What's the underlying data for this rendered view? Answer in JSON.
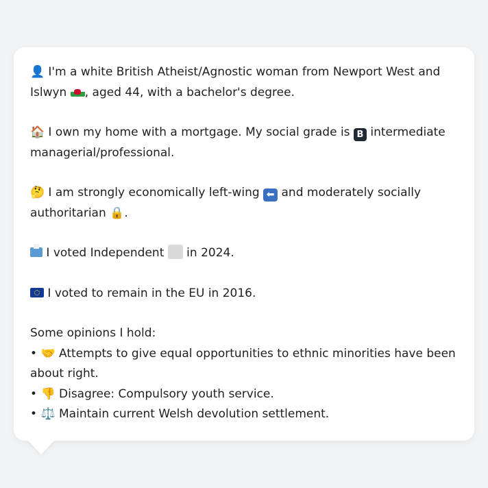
{
  "bio": {
    "line1_icon": "person-silhouette-icon",
    "line1_a": "I'm a white British Atheist/Agnostic woman from Newport West and Islwyn",
    "line1_flag": "wales-flag-icon",
    "line1_b": ", aged 44, with a bachelor's degree.",
    "line2_icon": "house-icon",
    "line2_a": "I own my home with a mortgage. My social grade is",
    "line2_badge": "B",
    "line2_b": "intermediate managerial/professional.",
    "line3_icon": "thinking-face-icon",
    "line3_a": "I am strongly economically left-wing",
    "line3_arrow": "⬅",
    "line3_b": "and moderately socially authoritarian",
    "line3_lock": "🔒",
    "line3_end": ".",
    "line4_icon": "ballot-box-icon",
    "line4_a": "I voted Independent",
    "line4_b": "in 2024.",
    "line5_icon": "eu-flag-icon",
    "line5_a": "I voted to remain in the EU in 2016."
  },
  "opinions": {
    "heading": "Some opinions I hold:",
    "items": [
      {
        "bullet": "•",
        "icon": "🤝",
        "text": "Attempts to give equal opportunities to ethnic minorities have been about right."
      },
      {
        "bullet": "•",
        "icon": "👎",
        "text": "Disagree: Compulsory youth service."
      },
      {
        "bullet": "•",
        "icon": "⚖️",
        "text": "Maintain current Welsh devolution settlement."
      }
    ]
  },
  "emoji": {
    "person": "👤",
    "house": "🏠",
    "thinking": "🤔"
  }
}
